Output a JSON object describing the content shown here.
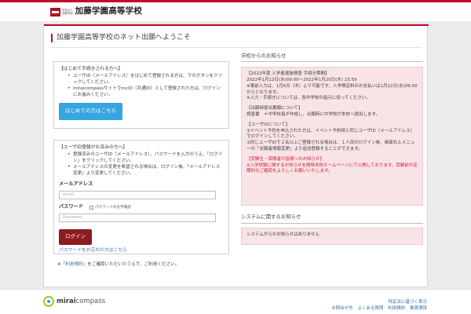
{
  "header": {
    "school_small_1": "学校法人",
    "school_small_2": "加藤学園",
    "school_name": "加藤学園高等学校"
  },
  "page": {
    "welcome_title": "加藤学園高等学校のネット出願へようこそ"
  },
  "first_time": {
    "title": "【はじめて手続きされる方へ】",
    "bullet1": "ユーザID（メールアドレス）をはじめて登録される方は、下のボタンをクリックしてください。",
    "bullet2": "miraicompassサイトでmcID（共通ID）として登録された方は、ログインにお進みください。",
    "button_label": "はじめての方はこちら"
  },
  "login": {
    "title": "【ユーザID登録がお済みの方へ】",
    "bullet1": "登録済みのユーザID（メールアドレス）、パスワードを入力のうえ、「ログイン」をクリックしてください。",
    "bullet2": "メールアドレスの変更を希望される場合は、ログイン後、「メールアドレス変更」より変更してください。",
    "email_label": "メールアドレス",
    "email_placeholder": "email",
    "password_label": "パスワード",
    "show_password_label": "パスワードの文字確認",
    "password_placeholder": "Password",
    "login_button": "ログイン",
    "forgot_link": "パスワードをお忘れの方はこちら"
  },
  "terms": {
    "prefix": "※「",
    "link": "利用規約",
    "suffix": "」をご確認いただいたうえで、ご利用ください。"
  },
  "school_notice": {
    "title": "学校からのお知らせ",
    "lines": [
      "【2022年度 入学者選抜検査 手続き期間】",
      "2022年1月12日(水)09:00～2022年1月20日(木) 23:59",
      "※事前入力は、1月6日（木）より可能です。入学検定料のお支払いは1月12日(水)09:00からとなります。",
      "※入力・手続きについては、各中学校の指示に従ってください。",
      "【出願時提出書類について】",
      "調査書　＊中学校長が作成し、出願時に中学校が本校へ提出します。",
      "【ユーザIDについて】",
      "①イベント予約を申込された方は、イベント予約時と同じユーザID（メールアドレス）でログインしてください。",
      "②同じユーザIDで２名以上ご登録される場合は、１人目のログイン後、画面右上メニューの「志願者情報変更」より追加登録することができます。",
      "【受験生・保護者の皆様へのお知らせ】",
      "※入学試験に関するお知らせを随時本校ホームページにて公開しております。受験前の定期的なご確認をよろしくお願いいたします。"
    ]
  },
  "system_notice": {
    "title": "システムに関するお知らせ",
    "text": "システムからのお知らせはありません"
  },
  "footer": {
    "brand_prefix": "mirai",
    "brand_suffix": "compass",
    "link1": "特定法に基づく表示",
    "link2": "お問合せ先",
    "link3": "よくある質問",
    "link4": "利用規約",
    "link5": "推奨環境"
  },
  "colors": {
    "brand_red": "#c40d2a",
    "login_button": "#8e1b1f",
    "first_time_button": "#37a5e1",
    "notice_bg": "#f8e3e6",
    "link": "#2d6fb5"
  }
}
